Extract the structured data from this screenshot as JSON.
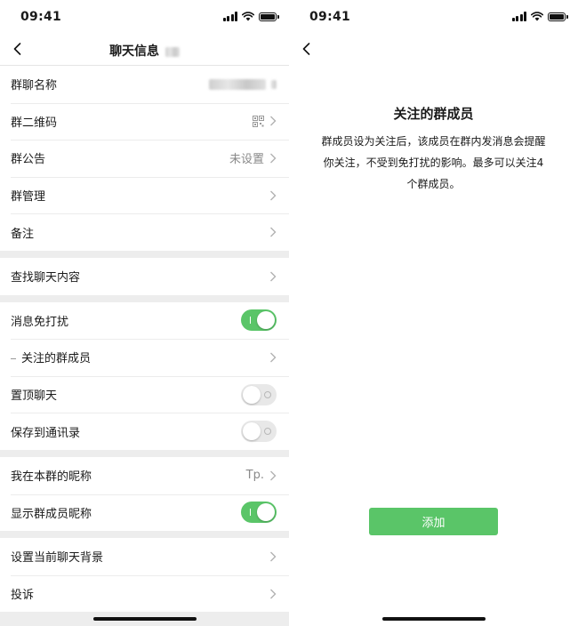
{
  "left": {
    "status_time": "09:41",
    "nav_title": "聊天信息",
    "rows": {
      "group_name": {
        "label": "群聊名称"
      },
      "qr_code": {
        "label": "群二维码"
      },
      "announcement": {
        "label": "群公告",
        "value": "未设置"
      },
      "management": {
        "label": "群管理"
      },
      "remark": {
        "label": "备注"
      },
      "search_history": {
        "label": "查找聊天内容"
      },
      "mute": {
        "label": "消息免打扰",
        "on": true
      },
      "followed_members": {
        "label": "关注的群成员"
      },
      "pin_chat": {
        "label": "置顶聊天",
        "on": false
      },
      "save_contacts": {
        "label": "保存到通讯录",
        "on": false
      },
      "my_nickname": {
        "label": "我在本群的昵称",
        "value": "Tp."
      },
      "show_nicknames": {
        "label": "显示群成员昵称",
        "on": true
      },
      "background": {
        "label": "设置当前聊天背景"
      },
      "report": {
        "label": "投诉"
      }
    }
  },
  "right": {
    "status_time": "09:41",
    "title": "关注的群成员",
    "description_lines": [
      "群成员设为关注后，该成员在群内发消息会提醒",
      "你关注，不受到免打扰的影响。最多可以关注4",
      "个群成员。"
    ],
    "add_button": "添加"
  },
  "colors": {
    "accent_green": "#5ac568",
    "page_background": "#ededed",
    "secondary_text": "#8a8a8a"
  }
}
